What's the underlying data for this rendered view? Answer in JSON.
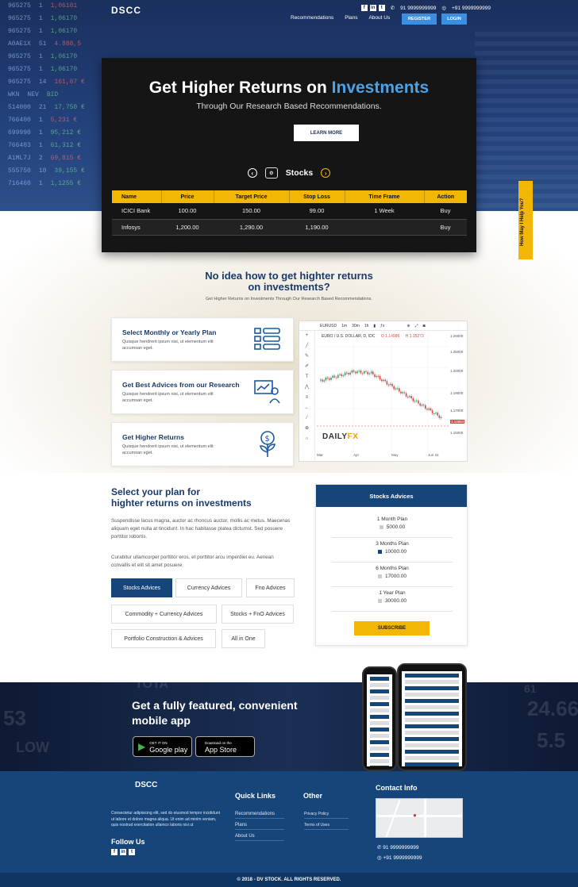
{
  "header": {
    "logo_text": "DSCC",
    "phone_1": "91 9999999999",
    "phone_2": "+91 9999999999",
    "nav": [
      "Recommendations",
      "Plans",
      "About Us"
    ],
    "register_label": "REGISTER",
    "login_label": "LOGIN"
  },
  "ticker": [
    [
      "965275",
      "1",
      "1,06181"
    ],
    [
      "965275",
      "1",
      "1,06170"
    ],
    [
      "965275",
      "1",
      "1,06170"
    ],
    [
      "A0AE1X",
      "51",
      "4.888,5"
    ],
    [
      "965275",
      "1",
      "1,06170"
    ],
    [
      "965275",
      "1",
      "1,06170"
    ],
    [
      "965275",
      "14",
      "161,87 €"
    ]
  ],
  "hero": {
    "title_plain": "Get Higher Returns on ",
    "title_highlight": "Investments",
    "subtitle": "Through Our Research Based Recommendations.",
    "learn_more": "LEARN MORE",
    "stocks_label": "Stocks",
    "table_headers": [
      "Name",
      "Price",
      "Target Price",
      "Stop Loss",
      "Time Frame",
      "Action"
    ],
    "table_rows": [
      [
        "ICICI Bank",
        "100.00",
        "150.00",
        "99.00",
        "1 Week",
        "Buy"
      ],
      [
        "Infosys",
        "1,200.00",
        "1,290.00",
        "1,190.00",
        "",
        "Buy"
      ]
    ],
    "help_tab": "How May I Help You?"
  },
  "section2": {
    "title_line1": "No idea how to get highter returns",
    "title_line2": "on investments?",
    "subtitle": "Get Higher Returns on Investments Through Our Research Based Recommendations.",
    "cards": [
      {
        "title": "Select Monthly or Yearly Plan",
        "text": "Quisque hendrerit ipsum nisi, ut elementum elit accumsan eget."
      },
      {
        "title": "Get Best Advices from our Research",
        "text": "Quisque hendrerit ipsum nisi, ut elementum elit accumsan eget."
      },
      {
        "title": "Get Higher Returns",
        "text": "Quisque hendrerit ipsum nisi, ut elementum elit accumsan eget."
      }
    ],
    "chart": {
      "symbol": "EURUSD",
      "intervals": [
        "1m",
        "30m",
        "1h"
      ],
      "header": "EURO / U.S. DOLLAR, D, IDC",
      "o_value": "O 1.14986",
      "h_value": "H 1.15273",
      "brand_a": "DAILY",
      "brand_b": "FX",
      "y_ticks": [
        "1.26000",
        "1.25000",
        "1.20000",
        "1.19000",
        "1.17000",
        "1.15000"
      ],
      "x_ticks": [
        "Mar",
        "Apr",
        "May",
        "Jun 22"
      ],
      "last_price": "1.14964"
    }
  },
  "section3": {
    "title_line1": "Select your plan for",
    "title_line2": "highter returns on investments",
    "para1": "Suspendisse lacus magna, auctor ac rhoncus auctor, mollis ac metus. Maecenas aliquam eget nulla at tincidunt. In hac habitasse platea dictumst. Sed posuere porttitor lobortis.",
    "para2": "Curabitur ullamcorper porttitor eros, et porttitor arcu imperdiet eu. Aenean convallis et elit sit amet posuere.",
    "plans": [
      "Stocks Advices",
      "Currency Advices",
      "Fno Advices",
      "Commodity + Currency Advices",
      "Stocks + FnO Advices",
      "Portfolio Construction & Advices",
      "All in One"
    ],
    "advice_box": {
      "title": "Stocks Advices",
      "items": [
        {
          "name": "1 Month Plan",
          "price": "5000.00",
          "selected": false
        },
        {
          "name": "3 Months Plan",
          "price": "10000.00",
          "selected": true
        },
        {
          "name": "6 Months Plan",
          "price": "17000.00",
          "selected": false
        },
        {
          "name": "1 Year Plan",
          "price": "30000.00",
          "selected": false
        }
      ],
      "subscribe": "SUBSCRIBE"
    }
  },
  "app": {
    "title_line1": "Get a fully featured, convenient",
    "title_line2": "mobile app",
    "gplay_small": "GET IT ON",
    "gplay_big": "Google play",
    "appstore_small": "Download on the",
    "appstore_big": "App Store",
    "bg_numbers": [
      "53",
      "LOW",
      "TOTA",
      "24.66",
      "5.5",
      "61"
    ]
  },
  "footer": {
    "logo_text": "DSCC",
    "description": "Consectetur adipisicing elit, sed do eiusmod tempor incididunt ut labore et dolore magna aliqua. Ut enim ad minim veniam, quis nostrud exercitation ullamco laboris nisi ut",
    "follow_us": "Follow Us",
    "quick_links_title": "Quick Links",
    "quick_links": [
      "Recommendations",
      "Plans",
      "About Us"
    ],
    "other_title": "Other",
    "other_links": [
      "Privacy Policy",
      "Terms of Uses"
    ],
    "contact_title": "Contact Info",
    "phone_1": "91 9999999999",
    "phone_2": "+91 9999999999",
    "copyright": "© 2018 - DV STOCK. ALL RIGHTS RESERVED."
  }
}
